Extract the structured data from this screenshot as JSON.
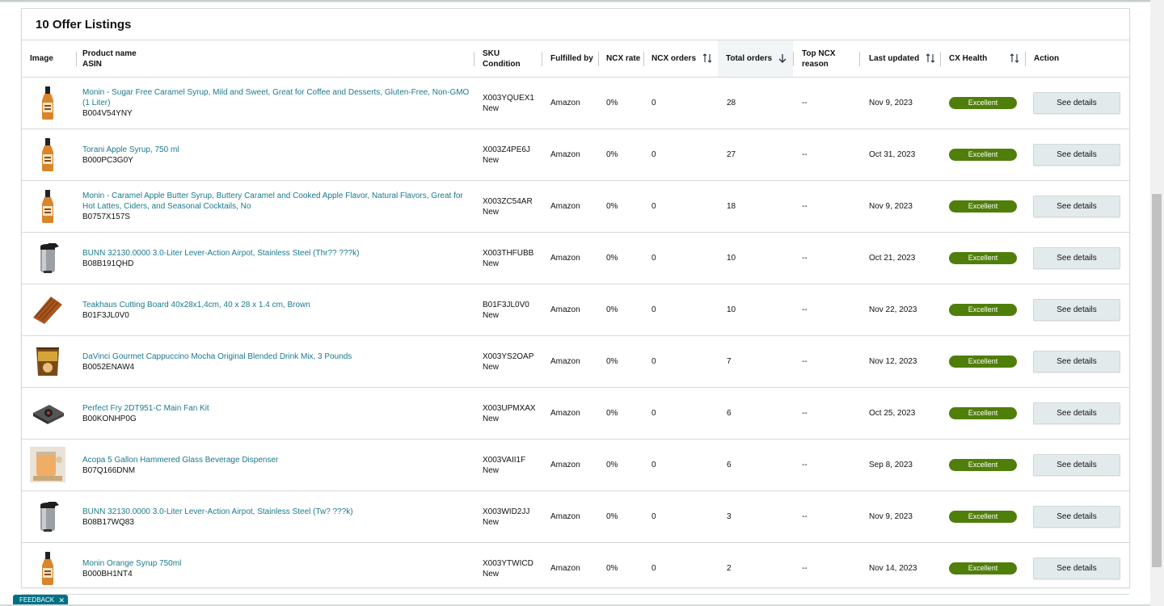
{
  "title": "10 Offer Listings",
  "columns": {
    "image": "Image",
    "product_name": "Product name",
    "asin": "ASIN",
    "sku": "SKU",
    "condition": "Condition",
    "fulfilled_by": "Fulfilled by",
    "ncx_rate": "NCX rate",
    "ncx_orders": "NCX orders",
    "total_orders": "Total orders",
    "top_ncx_reason_1": "Top NCX",
    "top_ncx_reason_2": "reason",
    "last_updated": "Last updated",
    "cx_health": "CX Health",
    "action": "Action"
  },
  "rows": [
    {
      "name": "Monin - Sugar Free Caramel Syrup, Mild and Sweet, Great for Coffee and Desserts, Gluten-Free, Non-GMO (1 Liter)",
      "asin": "B004V54YNY",
      "sku": "X003YQUEX1",
      "condition": "New",
      "fulfilled": "Amazon",
      "ncx_rate": "0%",
      "ncx_orders": "0",
      "total": "28",
      "reason": "--",
      "updated": "Nov 9, 2023",
      "health": "Excellent",
      "action": "See details",
      "image_icon": "syrup-bottle-icon"
    },
    {
      "name": "Torani Apple Syrup, 750 ml",
      "asin": "B000PC3G0Y",
      "sku": "X003Z4PE6J",
      "condition": "New",
      "fulfilled": "Amazon",
      "ncx_rate": "0%",
      "ncx_orders": "0",
      "total": "27",
      "reason": "--",
      "updated": "Oct 31, 2023",
      "health": "Excellent",
      "action": "See details",
      "image_icon": "syrup-bottle-icon"
    },
    {
      "name": "Monin - Caramel Apple Butter Syrup, Buttery Caramel and Cooked Apple Flavor, Natural Flavors, Great for Hot Lattes, Ciders, and Seasonal Cocktails, No",
      "asin": "B0757X157S",
      "sku": "X003ZC54AR",
      "condition": "New",
      "fulfilled": "Amazon",
      "ncx_rate": "0%",
      "ncx_orders": "0",
      "total": "18",
      "reason": "--",
      "updated": "Nov 9, 2023",
      "health": "Excellent",
      "action": "See details",
      "image_icon": "syrup-bottle-icon"
    },
    {
      "name": "BUNN 32130.0000 3.0-Liter Lever-Action Airpot, Stainless Steel (Thr?? ???k)",
      "asin": "B08B191QHD",
      "sku": "X003THFUBB",
      "condition": "New",
      "fulfilled": "Amazon",
      "ncx_rate": "0%",
      "ncx_orders": "0",
      "total": "10",
      "reason": "--",
      "updated": "Oct 21, 2023",
      "health": "Excellent",
      "action": "See details",
      "image_icon": "airpot-icon"
    },
    {
      "name": "Teakhaus Cutting Board 40x28x1,4cm, 40 x 28 x 1.4 cm, Brown",
      "asin": "B01F3JL0V0",
      "sku": "B01F3JL0V0",
      "condition": "New",
      "fulfilled": "Amazon",
      "ncx_rate": "0%",
      "ncx_orders": "0",
      "total": "10",
      "reason": "--",
      "updated": "Nov 22, 2023",
      "health": "Excellent",
      "action": "See details",
      "image_icon": "cutting-board-icon"
    },
    {
      "name": "DaVinci Gourmet Cappuccino Mocha Original Blended Drink Mix, 3 Pounds",
      "asin": "B0052ENAW4",
      "sku": "X003YS2OAP",
      "condition": "New",
      "fulfilled": "Amazon",
      "ncx_rate": "0%",
      "ncx_orders": "0",
      "total": "7",
      "reason": "--",
      "updated": "Nov 12, 2023",
      "health": "Excellent",
      "action": "See details",
      "image_icon": "drink-mix-bag-icon"
    },
    {
      "name": "Perfect Fry 2DT951-C Main Fan Kit",
      "asin": "B00KONHP0G",
      "sku": "X003UPMXAX",
      "condition": "New",
      "fulfilled": "Amazon",
      "ncx_rate": "0%",
      "ncx_orders": "0",
      "total": "6",
      "reason": "--",
      "updated": "Oct 25, 2023",
      "health": "Excellent",
      "action": "See details",
      "image_icon": "fan-kit-icon"
    },
    {
      "name": "Acopa 5 Gallon Hammered Glass Beverage Dispenser",
      "asin": "B07Q166DNM",
      "sku": "X003VAII1F",
      "condition": "New",
      "fulfilled": "Amazon",
      "ncx_rate": "0%",
      "ncx_orders": "0",
      "total": "6",
      "reason": "--",
      "updated": "Sep 8, 2023",
      "health": "Excellent",
      "action": "See details",
      "image_icon": "beverage-dispenser-icon"
    },
    {
      "name": "BUNN 32130.0000 3.0-Liter Lever-Action Airpot, Stainless Steel (Tw? ???k)",
      "asin": "B08B17WQ83",
      "sku": "X003WID2JJ",
      "condition": "New",
      "fulfilled": "Amazon",
      "ncx_rate": "0%",
      "ncx_orders": "0",
      "total": "3",
      "reason": "--",
      "updated": "Nov 9, 2023",
      "health": "Excellent",
      "action": "See details",
      "image_icon": "airpot-icon"
    },
    {
      "name": "Monin Orange Syrup 750ml",
      "asin": "B000BH1NT4",
      "sku": "X003YTWICD",
      "condition": "New",
      "fulfilled": "Amazon",
      "ncx_rate": "0%",
      "ncx_orders": "0",
      "total": "2",
      "reason": "--",
      "updated": "Nov 14, 2023",
      "health": "Excellent",
      "action": "See details",
      "image_icon": "syrup-bottle-icon"
    }
  ],
  "feedback": "FEEDBACK",
  "colors": {
    "link": "#1a7a8c",
    "badge": "#507e0a",
    "button": "#e3eaec",
    "feedback": "#007185"
  }
}
